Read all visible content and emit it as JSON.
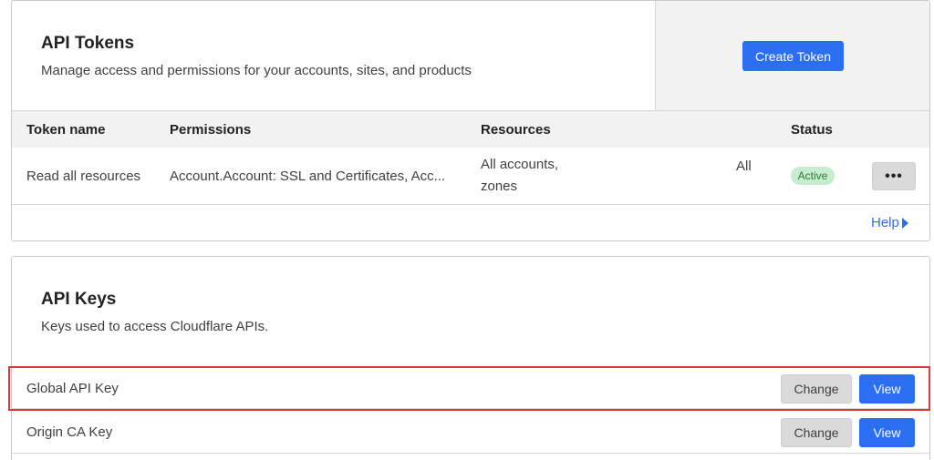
{
  "api_tokens": {
    "title": "API Tokens",
    "description": "Manage access and permissions for your accounts, sites, and products",
    "create_button": "Create Token",
    "columns": {
      "token_name": "Token name",
      "permissions": "Permissions",
      "resources": "Resources",
      "status": "Status"
    },
    "rows": [
      {
        "name": "Read all resources",
        "permissions": "Account.Account: SSL and Certificates, Acc...",
        "resources_line1": "All accounts,",
        "resources_line2": "zones",
        "resources_extra": "All",
        "status": "Active",
        "menu": "•••"
      }
    ],
    "help_link": "Help"
  },
  "api_keys": {
    "title": "API Keys",
    "description": "Keys used to access Cloudflare APIs.",
    "rows": [
      {
        "label": "Global API Key",
        "change_button": "Change",
        "view_button": "View"
      },
      {
        "label": "Origin CA Key",
        "change_button": "Change",
        "view_button": "View"
      }
    ]
  },
  "colors": {
    "primary": "#2c6ef2",
    "active_badge_bg": "#c8ecd0",
    "highlight": "#d83a3a"
  }
}
